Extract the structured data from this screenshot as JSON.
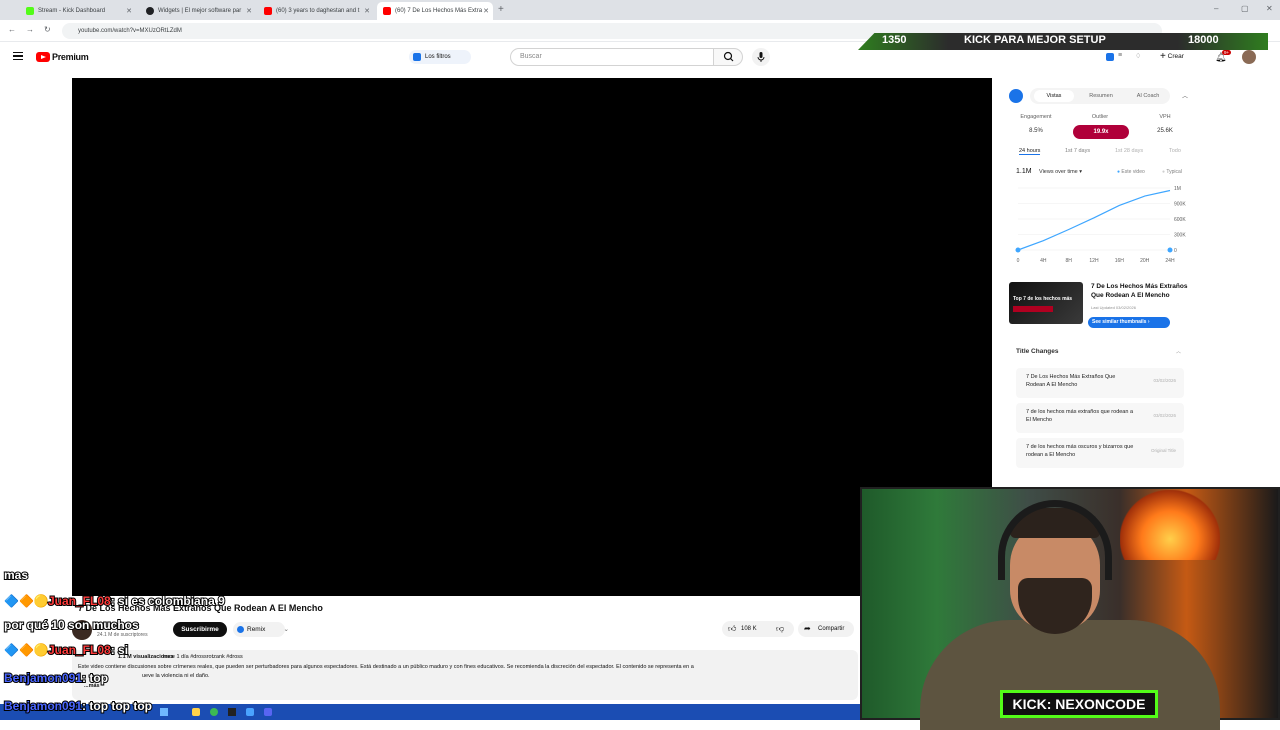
{
  "browser": {
    "tabs": [
      {
        "label": "Stream - Kick Dashboard",
        "favicon_color": "#53fc18"
      },
      {
        "label": "Widgets | El mejor software par",
        "favicon_color": "#202124"
      },
      {
        "label": "(60) 3 years to daghestan and t",
        "favicon_color": "#ff0000"
      },
      {
        "label": "(60) 7 De Los Hechos Más Extra",
        "favicon_color": "#ff0000"
      }
    ],
    "url": "youtube.com/watch?v=MXUzORtLZdM"
  },
  "youtube": {
    "brand": "Premium",
    "filters_label": "Los filtros",
    "search_placeholder": "Buscar",
    "create_label": "Crear",
    "notification_count": "9+"
  },
  "panel": {
    "tabs": [
      "Vistas",
      "Resumen",
      "AI Coach"
    ],
    "metrics": [
      {
        "label": "Engagement",
        "value": "8.5%"
      },
      {
        "label": "Outlier",
        "value": "19.9x"
      },
      {
        "label": "VPH",
        "value": "25.6K"
      }
    ],
    "timeframes": [
      "24 hours",
      "1st 7 days",
      "1st 28 days",
      "Todo"
    ],
    "views_total": "1.1M",
    "views_selector": "Views over time",
    "legend": [
      "Este video",
      "Typical"
    ],
    "video_title": "7 De Los Hechos Más Extraños Que Rodean A El Mencho",
    "last_updated": "Last Updated 03/02/2026",
    "thumbnail_text": "Top 7 de los hechos más",
    "similar_button": "See similar thumbnails",
    "title_changes_header": "Title Changes",
    "title_changes": [
      {
        "title": "7 De Los Hechos Más Extraños Que Rodean A El Mencho",
        "date": "03/02/2026"
      },
      {
        "title": "7 de los hechos más extraños que rodean a El Mencho",
        "date": "03/02/2026"
      },
      {
        "title": "7 de los hechos más oscuros y bizarros que rodean a El Mencho",
        "date": "Original Title"
      }
    ]
  },
  "chart_data": {
    "type": "line",
    "x": [
      "0",
      "4H",
      "8H",
      "12H",
      "16H",
      "20H",
      "24H"
    ],
    "series": [
      {
        "name": "Este video",
        "values": [
          0,
          150000,
          330000,
          520000,
          720000,
          870000,
          960000
        ]
      }
    ],
    "yticks": [
      "1M",
      "900K",
      "600K",
      "300K",
      "0"
    ],
    "ylim": [
      0,
      1000000
    ],
    "color": "#3ea6ff"
  },
  "video": {
    "title": "7 De Los Hechos Más Extraños Que Rodean A El Mencho",
    "subscribers": "24.1 M de suscriptores",
    "subscribe_label": "Suscribirme",
    "remix_label": "Remix",
    "likes": "108 K",
    "share_label": "Compartir",
    "meta": "hace 1 día  #drossrotzank #dross",
    "views": "1.1 M visualizaciones",
    "description": "Este video contiene discusiones sobre crímenes reales, que pueden ser perturbadores para algunos espectadores. Está destinado a un público maduro y con fines educativos.  Se recomienda la discreción del espectador.  El contenido se representa en a",
    "description_line2": "ueve la violencia ni el daño.",
    "more_label": "...más"
  },
  "stream": {
    "goal_left": "1350",
    "goal_text": "KICK PARA MEJOR SETUP",
    "goal_right": "18000",
    "kick_tag": "KICK: NEXONCODE",
    "chat": [
      {
        "user": "",
        "text": "mas"
      },
      {
        "user": "Juan_FL08",
        "text": ": si es colombiana 9"
      },
      {
        "user": "",
        "text": "por qué 10 son muchos"
      },
      {
        "user": "Juan_FL08",
        "text": ": si"
      },
      {
        "user": "Benjamon091",
        "text": ": top"
      },
      {
        "user": "Benjamon091",
        "text": ": top top top"
      }
    ]
  }
}
